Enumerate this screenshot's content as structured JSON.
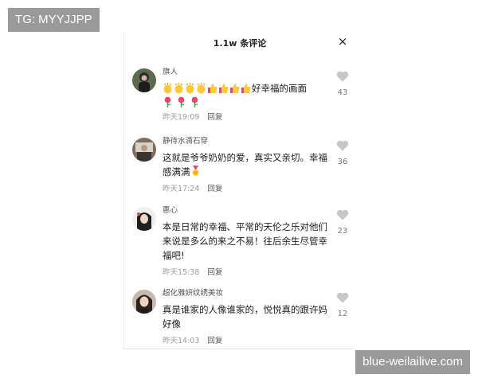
{
  "watermarks": {
    "top_left": "TG: MYYJJPP",
    "bottom_right": "blue-weilailive.com"
  },
  "header": {
    "title": "1.1w 条评论",
    "close_label": "×"
  },
  "colors": {
    "like_icon": "#c7c7c7",
    "secondary_text": "#9a9a9a"
  },
  "comments": [
    {
      "username": "旗人",
      "text": "好幸福的画面",
      "emoji_before_text": [
        "clap-emoji",
        "clap-emoji",
        "clap-emoji",
        "clap-emoji",
        "thumbs-up-emoji",
        "thumbs-up-emoji",
        "thumbs-up-emoji",
        "thumbs-up-emoji"
      ],
      "emoji_after_text": [
        "rose-emoji",
        "rose-emoji",
        "rose-emoji"
      ],
      "time": "昨天19:09",
      "reply": "回复",
      "likes": "43"
    },
    {
      "username": "静待水滴石穿",
      "text": "这就是爷爷奶奶的爱，真实又亲切。幸福感满满",
      "emoji_after_text": [
        "medal-emoji"
      ],
      "time": "昨天17:24",
      "reply": "回复",
      "likes": "36"
    },
    {
      "username": "惠心",
      "text": "本是日常的幸福、平常的天伦之乐对他们来说是多么的来之不易！往后余生尽管幸福吧!",
      "time": "昨天15:38",
      "reply": "回复",
      "likes": "23"
    },
    {
      "username": "超化雅妍纹绣美妆",
      "text": "真是谁家的人像谁家的，悦悦真的跟许妈好像",
      "time": "昨天14:03",
      "reply": "回复",
      "likes": "12"
    }
  ]
}
